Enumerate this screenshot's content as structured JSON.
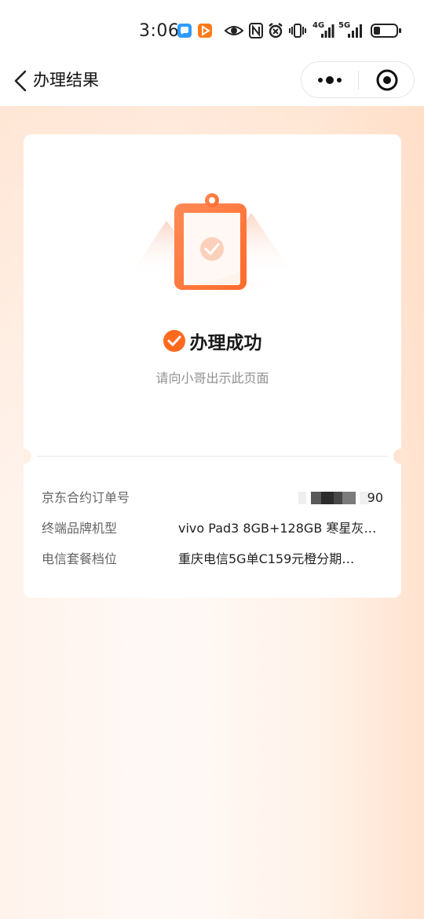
{
  "status_bar": {
    "time": "3:06",
    "network_4g": "4G",
    "network_5g": "5G",
    "colors": {
      "app1": "#2f9bff",
      "app2": "#ff7a1a"
    },
    "icons": [
      "chat-app-icon",
      "video-app-icon",
      "eye-icon",
      "nfc-icon",
      "alarm-icon",
      "vibrate-icon",
      "signal-4g-icon",
      "signal-5g-icon",
      "battery-icon"
    ]
  },
  "nav": {
    "title": "办理结果",
    "icons": [
      "back-icon",
      "more-icon",
      "close-target-icon"
    ]
  },
  "result": {
    "title": "办理成功",
    "hint": "请向小哥出示此页面",
    "accent_color": "#ff6a1f"
  },
  "details": [
    {
      "label": "京东合约订单号",
      "value": "90"
    },
    {
      "label": "终端品牌机型",
      "value": "vivo Pad3 8GB+128GB 寒星灰…"
    },
    {
      "label": "电信套餐档位",
      "value": "重庆电信5G单C159元橙分期…"
    }
  ]
}
